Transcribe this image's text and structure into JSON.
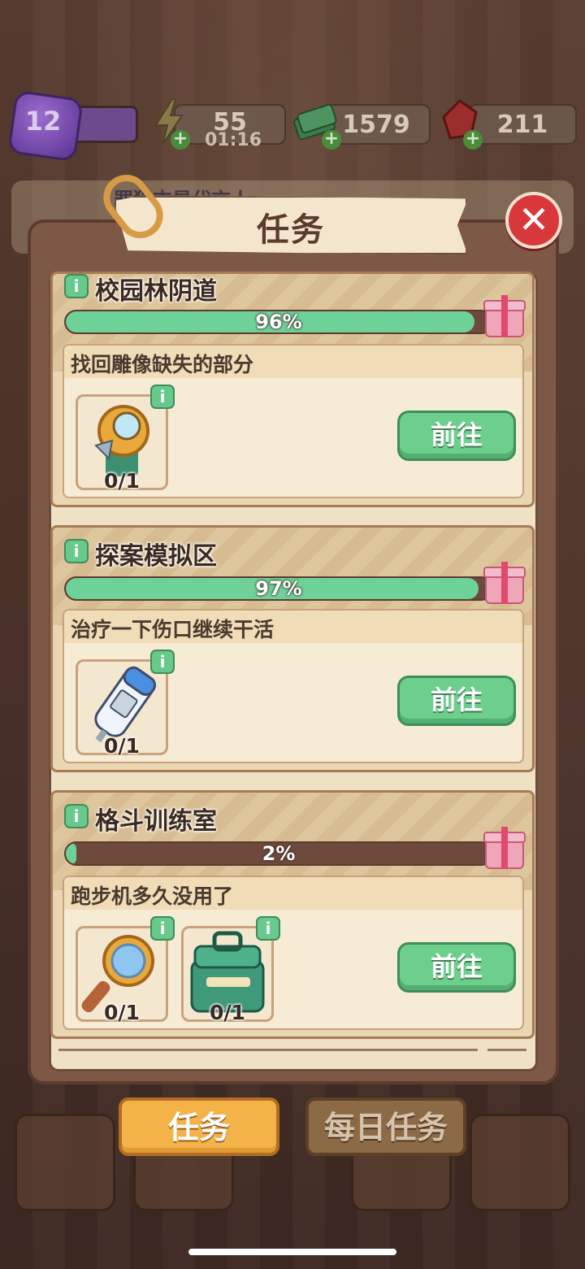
{
  "hud": {
    "level": "12",
    "energy": "55",
    "energy_timer": "01:16",
    "cash": "1579",
    "gems": "211",
    "plus": "+"
  },
  "background_banner": "罪犯支是代言人",
  "modal": {
    "title": "任务",
    "close_symbol": "✕"
  },
  "tasks": [
    {
      "area": "校园林阴道",
      "progress": 0.96,
      "progress_label": "96%",
      "description": "找回雕像缺失的部分",
      "items": [
        {
          "icon": "magnifier-lens-icon",
          "count": "0/1"
        }
      ],
      "button": "前往"
    },
    {
      "area": "探案模拟区",
      "progress": 0.97,
      "progress_label": "97%",
      "description": "治疗一下伤口继续干活",
      "items": [
        {
          "icon": "thermometer-icon",
          "count": "0/1"
        }
      ],
      "button": "前往"
    },
    {
      "area": "格斗训练室",
      "progress": 0.02,
      "progress_label": "2%",
      "description": "跑步机多久没用了",
      "items": [
        {
          "icon": "magnifying-glass-icon",
          "count": "0/1"
        },
        {
          "icon": "toolbox-icon",
          "count": "0/1"
        }
      ],
      "button": "前往"
    }
  ],
  "tabs": {
    "tasks": "任务",
    "daily": "每日任务"
  },
  "info_glyph": "i",
  "colors": {
    "progress_fill": "#6fd19a",
    "go_button": "#6ccf8b",
    "tab_active": "#f3b348",
    "close_button": "#d8383a"
  }
}
